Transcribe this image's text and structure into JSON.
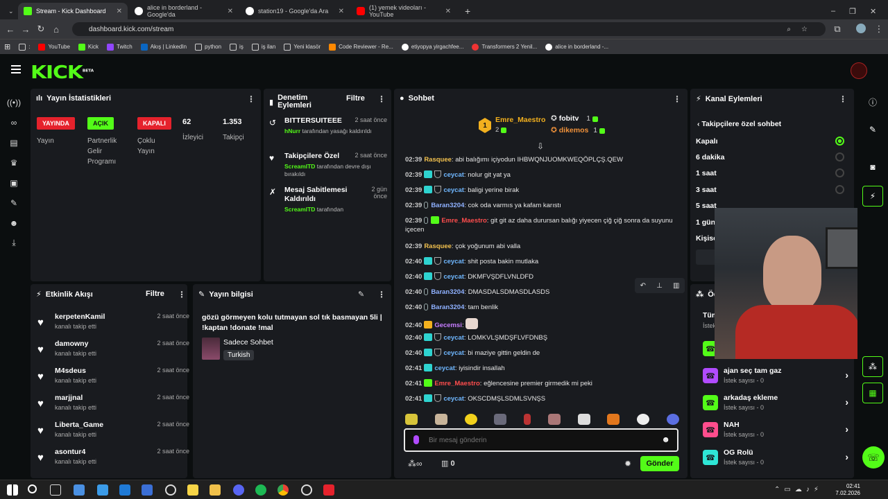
{
  "browser": {
    "tabs": [
      {
        "label": "Stream - Kick Dashboard",
        "active": true
      },
      {
        "label": "alice in borderland - Google'da"
      },
      {
        "label": "station19 - Google'da Ara"
      },
      {
        "label": "(1) yemek videoları - YouTube"
      }
    ],
    "url": "dashboard.kick.com/stream",
    "bookmarks": [
      "YouTube",
      "Kick",
      "Twitch",
      "Akış | LinkedIn",
      "python",
      "iş",
      "iş ilan",
      "Yeni klasör",
      "Code Reviewer - Re...",
      "etiyopya yirgachfee...",
      "Transformers 2 Yenil...",
      "alice in borderland -..."
    ],
    "colors": {
      "accent": "#53fc18"
    }
  },
  "logo": "KICK",
  "logo_beta": "BETA",
  "stats": {
    "title": "Yayın İstatistikleri",
    "live_badge": "YAYINDA",
    "live_label": "Yayın",
    "partner_badge": "AÇIK",
    "partner_label": "Partnerlik Gelir Programı",
    "multi_badge": "KAPALI",
    "multi_label": "Çoklu Yayın",
    "viewers": "62",
    "viewers_label": "İzleyici",
    "followers": "1.353",
    "followers_label": "Takipçi"
  },
  "mod": {
    "title": "Denetim Eylemleri",
    "filter": "Filtre",
    "items": [
      {
        "title": "BITTERSUITEEE",
        "user": "hNurr",
        "desc": " tarafından yasağı kaldırıldı",
        "time": "2 saat önce"
      },
      {
        "title": "Takipçilere Özel",
        "user": "ScreamITD",
        "desc": " tarafından devre dışı bırakıldı",
        "time": "2 saat önce"
      },
      {
        "title": "Mesaj Sabitlemesi Kaldırıldı",
        "user": "ScreamITD",
        "desc": " tarafından",
        "time": "2 gün önce"
      }
    ]
  },
  "chat": {
    "title": "Sohbet",
    "top": [
      {
        "rank": "1",
        "name": "Emre_Maestro",
        "count": "2"
      },
      {
        "name": "fobitv",
        "count": "1"
      },
      {
        "name": "dikemos",
        "count": "1"
      }
    ],
    "messages": [
      {
        "time": "02:39",
        "user": "Rasquee",
        "color": "#f2c14e",
        "text": "abi balığımı içiyodun IHBWQNJUOMKWEQÖPLÇŞ.QEW",
        "badges": ""
      },
      {
        "time": "02:39",
        "user": "ceycat",
        "color": "#6fb7ff",
        "text": "nolur git yat ya",
        "badges": "sub mod"
      },
      {
        "time": "02:39",
        "user": "ceycat",
        "color": "#6fb7ff",
        "text": "baligi yerine birak",
        "badges": "sub mod"
      },
      {
        "time": "02:39",
        "user": "Baran3204",
        "color": "#8fb1ff",
        "text": "cok oda varmıs ya kafam karıstı",
        "badges": "mic"
      },
      {
        "time": "02:39",
        "user": "Emre_Maestro",
        "color": "#ff4d4d",
        "text": "git git az daha durursan balığı yiyecen çiğ çiğ sonra da suyunu içecen",
        "badges": "mic vip"
      },
      {
        "time": "02:39",
        "user": "Rasquee",
        "color": "#f2c14e",
        "text": "çok yoğunum abi valla",
        "badges": ""
      },
      {
        "time": "02:40",
        "user": "ceycat",
        "color": "#6fb7ff",
        "text": "shit posta bakin mutlaka",
        "badges": "sub mod"
      },
      {
        "time": "02:40",
        "user": "ceycat",
        "color": "#6fb7ff",
        "text": "DKMFVŞDFLVNLDFD",
        "badges": "sub mod"
      },
      {
        "time": "02:40",
        "user": "Baran3204",
        "color": "#8fb1ff",
        "text": "DMASDALSDMASDLASDS",
        "badges": "mic"
      },
      {
        "time": "02:40",
        "user": "Baran3204",
        "color": "#8fb1ff",
        "text": "tam benlik",
        "badges": "mic"
      },
      {
        "time": "02:40",
        "user": "Gecemsi",
        "color": "#c77dff",
        "text": "",
        "badges": "crown"
      },
      {
        "time": "02:40",
        "user": "ceycat",
        "color": "#6fb7ff",
        "text": "LOMKVLŞMDŞFLVFDNBŞ",
        "badges": "sub mod"
      },
      {
        "time": "02:40",
        "user": "ceycat",
        "color": "#6fb7ff",
        "text": "bi maziye gittin geldin de",
        "badges": "sub mod"
      },
      {
        "time": "02:41",
        "user": "ceycat",
        "color": "#6fb7ff",
        "text": "iyisindir insallah",
        "badges": "sub"
      },
      {
        "time": "02:41",
        "user": "Emre_Maestro",
        "color": "#ff4d4d",
        "text": "eğlencesine premier girmedik mi peki",
        "badges": "vip"
      },
      {
        "time": "02:41",
        "user": "ceycat",
        "color": "#6fb7ff",
        "text": "OKSCDMŞLSDMLSVNŞS",
        "badges": "sub mod"
      }
    ],
    "placeholder": "Bir mesaj gönderin",
    "count": "0",
    "send": "Gönder"
  },
  "channel": {
    "title": "Kanal Eylemleri",
    "sub_title": "Takipçilere özel sohbet",
    "options": [
      {
        "label": "Kapalı",
        "selected": true
      },
      {
        "label": "6 dakika"
      },
      {
        "label": "1 saat"
      },
      {
        "label": "3 saat"
      },
      {
        "label": "5 saat"
      },
      {
        "label": "1 gün"
      },
      {
        "label": "Kişise"
      }
    ]
  },
  "events": {
    "title": "Etkinlik Akışı",
    "filter": "Filtre",
    "items": [
      {
        "name": "kerpetenKamil",
        "sub": "kanalı takip etti",
        "time": "2 saat önce"
      },
      {
        "name": "damowny",
        "sub": "kanalı takip etti",
        "time": "2 saat önce"
      },
      {
        "name": "M4sdeus",
        "sub": "kanalı takip etti",
        "time": "2 saat önce"
      },
      {
        "name": "marjjnal",
        "sub": "kanalı takip etti",
        "time": "2 saat önce"
      },
      {
        "name": "Liberta_Game",
        "sub": "kanalı takip etti",
        "time": "2 saat önce"
      },
      {
        "name": "asontur4",
        "sub": "kanalı takip etti",
        "time": "2 saat önce"
      }
    ]
  },
  "streaminfo": {
    "title": "Yayın bilgisi",
    "stream_title": "gözü görmeyen kolu tutmayan sol tık basmayan 5li | !kaptan !donate !mal",
    "category": "Sadece Sohbet",
    "language": "Turkish"
  },
  "rewards": {
    "title": "Öd",
    "tab": "Tüm",
    "tab_sub": "İstek",
    "items": [
      {
        "name": "ajan seç tam gaz",
        "sub": "İstek sayısı - 0",
        "color": "#b14bff"
      },
      {
        "name": "arkadaş ekleme",
        "sub": "İstek sayısı - 0",
        "color": "#53fc18"
      },
      {
        "name": "NAH",
        "sub": "İstek sayısı - 0",
        "color": "#ff4d8d"
      },
      {
        "name": "OG Rolü",
        "sub": "İstek sayısı - 0",
        "color": "#2ee6d6"
      }
    ]
  },
  "taskbar": {
    "time": "02:41",
    "date": "7.02.2026"
  }
}
